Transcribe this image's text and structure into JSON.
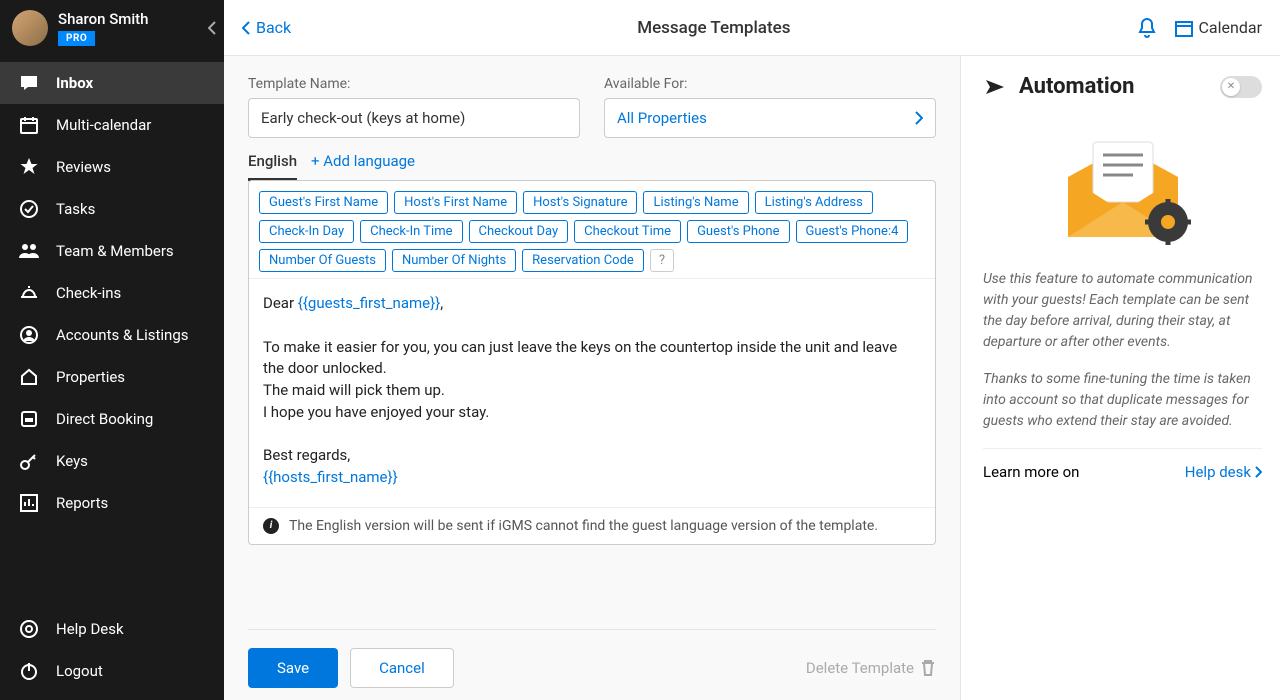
{
  "user": {
    "name": "Sharon Smith",
    "badge": "PRO"
  },
  "nav": {
    "items": [
      {
        "label": "Inbox",
        "icon": "inbox"
      },
      {
        "label": "Multi-calendar",
        "icon": "calendar"
      },
      {
        "label": "Reviews",
        "icon": "star"
      },
      {
        "label": "Tasks",
        "icon": "check"
      },
      {
        "label": "Team & Members",
        "icon": "team"
      },
      {
        "label": "Check-ins",
        "icon": "bell"
      },
      {
        "label": "Accounts & Listings",
        "icon": "account"
      },
      {
        "label": "Properties",
        "icon": "home"
      },
      {
        "label": "Direct Booking",
        "icon": "booking"
      },
      {
        "label": "Keys",
        "icon": "keys"
      },
      {
        "label": "Reports",
        "icon": "reports"
      }
    ],
    "footer": [
      {
        "label": "Help Desk",
        "icon": "help"
      },
      {
        "label": "Logout",
        "icon": "logout"
      }
    ]
  },
  "topbar": {
    "back": "Back",
    "title": "Message Templates",
    "calendar": "Calendar"
  },
  "form": {
    "name_label": "Template Name:",
    "name_value": "Early check-out (keys at home)",
    "avail_label": "Available For:",
    "avail_value": "All Properties"
  },
  "tabs": {
    "active": "English",
    "add": "+ Add language"
  },
  "tags": [
    "Guest's First Name",
    "Host's First Name",
    "Host's Signature",
    "Listing's Name",
    "Listing's Address",
    "Check-In Day",
    "Check-In Time",
    "Checkout Day",
    "Checkout Time",
    "Guest's Phone",
    "Guest's Phone:4",
    "Number Of Guests",
    "Number Of Nights",
    "Reservation Code"
  ],
  "body": {
    "l1a": "Dear ",
    "l1var": "{{guests_first_name}}",
    "l1b": ",",
    "l2": "To make it easier for you, you can just leave the keys on the countertop inside the unit and leave the door unlocked.",
    "l3": "The maid will pick them up.",
    "l4": "I hope you have enjoyed your stay.",
    "l5": "Best regards,",
    "l6var": "{{hosts_first_name}}"
  },
  "note": "The English version will be sent if iGMS cannot find the guest language version of the template.",
  "actions": {
    "save": "Save",
    "cancel": "Cancel",
    "delete": "Delete Template"
  },
  "panel": {
    "title": "Automation",
    "p1": "Use this feature to automate communication with your guests! Each template can be sent the day before arrival, during their stay, at departure or after other events.",
    "p2": "Thanks to some fine-tuning the time is taken into account so that duplicate messages for guests who extend their stay are avoided.",
    "learn": "Learn more on",
    "help": "Help desk"
  }
}
